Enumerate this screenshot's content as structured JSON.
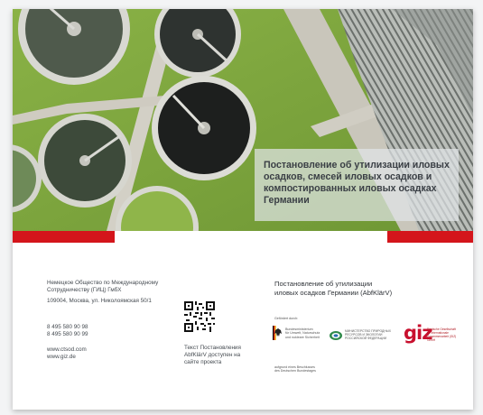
{
  "cover": {
    "title_lines": [
      "Постановление об утилизации иловых",
      "осадков, смесей иловых осадков и",
      "компостированных иловых осадках",
      "Германии"
    ]
  },
  "contact": {
    "org_line1": "Немецкое Общество по Международному",
    "org_line2": "Сотрудничеству (ГИЦ) ГмбХ",
    "address": "109004, Москва, ул. Николоямская 50/1",
    "phone1": "8 495 580 90 98",
    "phone2": "8 495 580 90 99",
    "web1": "www.ctsod.com",
    "web2": "www.giz.de"
  },
  "qr_caption": {
    "line1": "Текст Постановления",
    "line2": "AbfKlärV доступен на",
    "line3": "сайте проекта"
  },
  "doc_title": {
    "line1": "Постановление об утилизации",
    "line2": "иловых осадков  Германии (AbfKlärV)"
  },
  "logos": {
    "commissioned_by": "Gefördert durch:",
    "bmu_line1": "Bundesministerium",
    "bmu_line2": "für Umwelt, Naturschutz",
    "bmu_line3": "und nukleare Sicherheit",
    "ministry_line1": "МИНИСТЕРСТВО ПРИРОДНЫХ",
    "ministry_line2": "РЕСУРСОВ И ЭКОЛОГИИ",
    "ministry_line3": "РОССИЙСКОЙ ФЕДЕРАЦИИ",
    "giz_mark": "giz",
    "giz_text1": "Deutsche Gesellschaft",
    "giz_text2": "für Internationale",
    "giz_text3": "Zusammenarbeit (GIZ) GmbH",
    "bundestag_line1": "aufgrund eines Beschlusses",
    "bundestag_line2": "des Deutschen Bundestages"
  },
  "colors": {
    "accent_red": "#d4151b",
    "grass_green": "#7fa53c",
    "giz_red": "#c8102e"
  }
}
